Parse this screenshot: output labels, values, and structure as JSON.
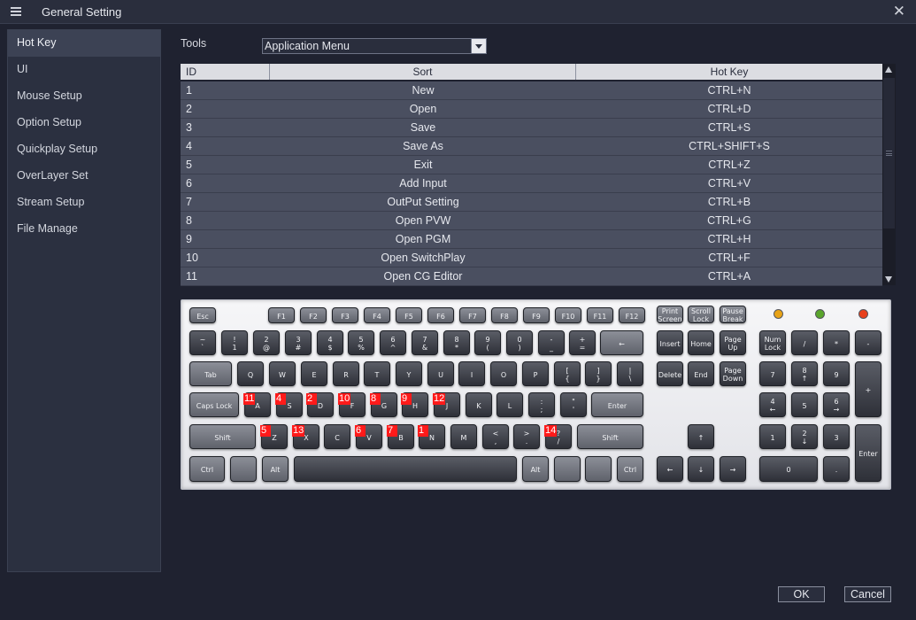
{
  "window": {
    "title": "General Setting"
  },
  "sidebar": {
    "items": [
      {
        "label": "Hot Key",
        "active": true
      },
      {
        "label": "UI"
      },
      {
        "label": "Mouse Setup"
      },
      {
        "label": "Option Setup"
      },
      {
        "label": "Quickplay Setup"
      },
      {
        "label": "OverLayer Set"
      },
      {
        "label": "Stream Setup"
      },
      {
        "label": "File Manage"
      }
    ]
  },
  "tools": {
    "label": "Tools",
    "selected": "Application Menu"
  },
  "table": {
    "headers": [
      "ID",
      "Sort",
      "Hot Key"
    ],
    "rows": [
      [
        "1",
        "New",
        "CTRL+N"
      ],
      [
        "2",
        "Open",
        "CTRL+D"
      ],
      [
        "3",
        "Save",
        "CTRL+S"
      ],
      [
        "4",
        "Save As",
        "CTRL+SHIFT+S"
      ],
      [
        "5",
        "Exit",
        "CTRL+Z"
      ],
      [
        "6",
        "Add Input",
        "CTRL+V"
      ],
      [
        "7",
        "OutPut Setting",
        "CTRL+B"
      ],
      [
        "8",
        "Open PVW",
        "CTRL+G"
      ],
      [
        "9",
        "Open PGM",
        "CTRL+H"
      ],
      [
        "10",
        "Open SwitchPlay",
        "CTRL+F"
      ],
      [
        "11",
        "Open CG Editor",
        "CTRL+A"
      ]
    ]
  },
  "keyboard": {
    "keys": {
      "esc": "Esc",
      "f1": "F1",
      "f2": "F2",
      "f3": "F3",
      "f4": "F4",
      "f5": "F5",
      "f6": "F6",
      "f7": "F7",
      "f8": "F8",
      "f9": "F9",
      "f10": "F10",
      "f11": "F11",
      "f12": "F12",
      "prtsc": "Print\nScreen",
      "scrlk": "Scroll\nLock",
      "pause": "Pause\nBreak",
      "tilde": "~\n`",
      "d1": "!\n1",
      "d2": "2\n@",
      "d3": "3\n#",
      "d4": "4\n$",
      "d5": "5\n%",
      "d6": "6\n^",
      "d7": "7\n&",
      "d8": "8\n*",
      "d9": "9\n(",
      "d0": "0\n)",
      "minus": "-\n_",
      "plus": "+\n=",
      "back": "←",
      "ins": "Insert",
      "home": "Home",
      "pgup": "Page\nUp",
      "numlk": "Num\nLock",
      "kdiv": "/",
      "kmul": "*",
      "ksub": "-",
      "tab": "Tab",
      "q": "Q",
      "w": "W",
      "e": "E",
      "r": "R",
      "t": "T",
      "y": "Y",
      "u": "U",
      "i": "I",
      "o": "O",
      "p": "P",
      "lbr": "[\n{",
      "rbr": "]\n}",
      "bsl": "|\n\\",
      "del": "Delete",
      "end": "End",
      "pgdn": "Page\nDown",
      "k7": "7",
      "k8": "8\n↑",
      "k9": "9",
      "kadd": "+",
      "caps": "Caps Lock",
      "a": "A",
      "s": "S",
      "d": "D",
      "f": "F",
      "g": "G",
      "h": "H",
      "j": "J",
      "k": "K",
      "l": "L",
      "semi": ":\n;",
      "quote": "\"\n'",
      "enter": "Enter",
      "k4": "4\n←",
      "k5": "5",
      "k6": "6\n→",
      "lshift": "Shift",
      "z": "Z",
      "x": "X",
      "c": "C",
      "v": "V",
      "b": "B",
      "n": "N",
      "m": "M",
      "comma": "<\n,",
      "period": ">\n.",
      "slash": "?\n/",
      "rshift": "Shift",
      "up": "↑",
      "k1": "1",
      "k2": "2\n↓",
      "k3": "3",
      "kent": "Enter",
      "lctrl": "Ctrl",
      "win": "",
      "lalt": "Alt",
      "space": "",
      "ralt": "Alt",
      "rwin": "",
      "menu": "",
      "rctrl": "Ctrl",
      "left": "←",
      "down": "↓",
      "right": "→",
      "k0": "0",
      "kdot": "."
    },
    "badges": [
      {
        "key": "a",
        "label": "11"
      },
      {
        "key": "s",
        "label": "4"
      },
      {
        "key": "d",
        "label": "2"
      },
      {
        "key": "f",
        "label": "10"
      },
      {
        "key": "g",
        "label": "8"
      },
      {
        "key": "h",
        "label": "9"
      },
      {
        "key": "j",
        "label": "12"
      },
      {
        "key": "z",
        "label": "5"
      },
      {
        "key": "x",
        "label": "13"
      },
      {
        "key": "v",
        "label": "6"
      },
      {
        "key": "b",
        "label": "7"
      },
      {
        "key": "n",
        "label": "1"
      },
      {
        "key": "slash",
        "label": "14"
      }
    ],
    "leds": [
      "#e8a317",
      "#5aa52c",
      "#e8401c"
    ]
  },
  "buttons": {
    "ok": "OK",
    "cancel": "Cancel"
  }
}
